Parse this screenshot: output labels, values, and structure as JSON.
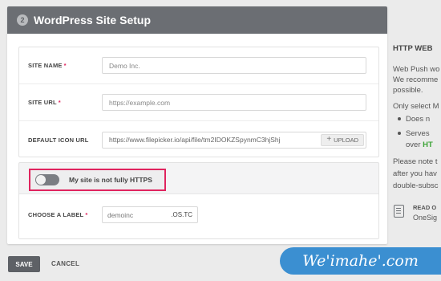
{
  "header": {
    "step": "2",
    "title": "WordPress Site Setup"
  },
  "fields": {
    "site_name": {
      "label": "SITE NAME",
      "required": "*",
      "placeholder": "Demo Inc."
    },
    "site_url": {
      "label": "SITE URL",
      "required": "*",
      "placeholder": "https://example.com"
    },
    "icon_url": {
      "label": "DEFAULT ICON URL",
      "value": "https://www.filepicker.io/api/file/tm2IDOKZSpynmC3hjShj",
      "upload_label": "UPLOAD"
    }
  },
  "https": {
    "toggle_label": "My site is not fully HTTPS",
    "toggle_on": false,
    "label_field": {
      "label": "CHOOSE A LABEL",
      "required": "*",
      "value": "demoinc",
      "suffix": ".OS.TC"
    }
  },
  "footer": {
    "save_label": "SAVE",
    "cancel_label": "CANCEL"
  },
  "sidebar": {
    "title": "HTTP WEB",
    "para1": [
      "Web Push wo",
      "We recomme",
      "possible."
    ],
    "only_select": "Only select M",
    "bullet1": "Does n",
    "bullet2": "Serves",
    "bullet2_cont_prefix": "over",
    "bullet2_cont_green": "HT",
    "para3": [
      "Please note t",
      "after you hav",
      "double-subsc"
    ],
    "read_label": "READ O",
    "read_link": "OneSig"
  },
  "watermark": "We'imahe'.com",
  "colors": {
    "header_bg": "#6b6e73",
    "highlight": "#e0245e",
    "required": "#e0245e",
    "watermark_bg": "#3b8fd1",
    "green": "#3aa335"
  }
}
